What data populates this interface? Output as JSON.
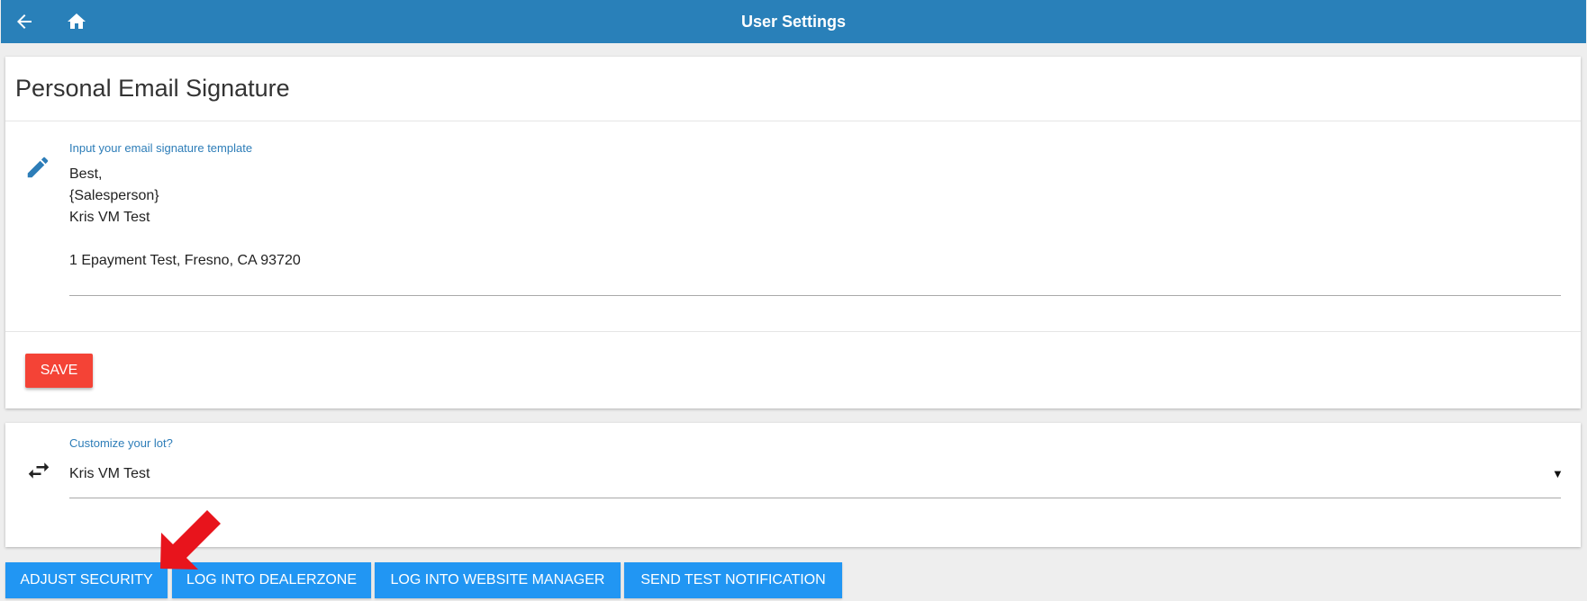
{
  "header": {
    "title": "User Settings",
    "back_icon": "arrow-left-icon",
    "home_icon": "home-icon",
    "bg_color": "#2980b9"
  },
  "signature_card": {
    "title": "Personal Email Signature",
    "icon": "pencil-icon",
    "field_label": "Input your email signature template",
    "value": "Best,\n{Salesperson}\nKris VM Test\n\n1 Epayment Test, Fresno, CA 93720",
    "save_label": "SAVE",
    "save_color": "#f44336"
  },
  "lot_card": {
    "icon": "swap-arrows-icon",
    "field_label": "Customize your lot?",
    "selected": "Kris VM Test"
  },
  "actions": {
    "adjust_security": "ADJUST SECURITY",
    "log_into_dealerzone": "LOG INTO DEALERZONE",
    "log_into_website_manager": "LOG INTO WEBSITE MANAGER",
    "send_test_notification": "SEND TEST NOTIFICATION",
    "button_color": "#2196f3"
  },
  "annotation": {
    "arrow_color": "#e8141c"
  }
}
